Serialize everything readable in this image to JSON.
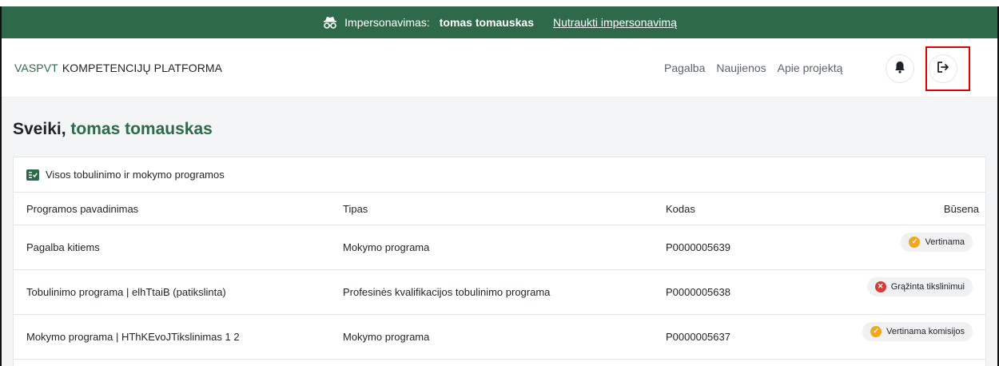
{
  "impersonation": {
    "label": "Impersonavimas:",
    "user": "tomas tomauskas",
    "stop_link": "Nutraukti impersonavimą"
  },
  "header": {
    "brand_prefix": "VASPVT",
    "brand_name": "KOMPETENCIJŲ PLATFORMA",
    "nav": [
      "Pagalba",
      "Naujienos",
      "Apie projektą"
    ]
  },
  "greeting": {
    "prefix": "Sveiki,",
    "name": "tomas tomauskas"
  },
  "programs": {
    "title": "Visos tobulinimo ir mokymo programos",
    "columns": [
      "Programos pavadinimas",
      "Tipas",
      "Kodas",
      "Būsena"
    ],
    "rows": [
      {
        "name": "Pagalba kitiems",
        "type": "Mokymo programa",
        "code": "P0000005639",
        "status": "Vertinama",
        "status_kind": "warning"
      },
      {
        "name": "Tobulinimo programa | elhTtaiB (patikslinta)",
        "type": "Profesinės kvalifikacijos tobulinimo programa",
        "code": "P0000005638",
        "status": "Grąžinta tikslinimui",
        "status_kind": "error"
      },
      {
        "name": "Mokymo programa | HThKEvoJTikslinimas 1 2",
        "type": "Mokymo programa",
        "code": "P0000005637",
        "status": "Vertinama komisijos",
        "status_kind": "warning"
      }
    ]
  },
  "colors": {
    "brand_green": "#2e6a4a",
    "warning": "#f0a81e",
    "error": "#d63b3b",
    "highlight": "#e00000"
  }
}
